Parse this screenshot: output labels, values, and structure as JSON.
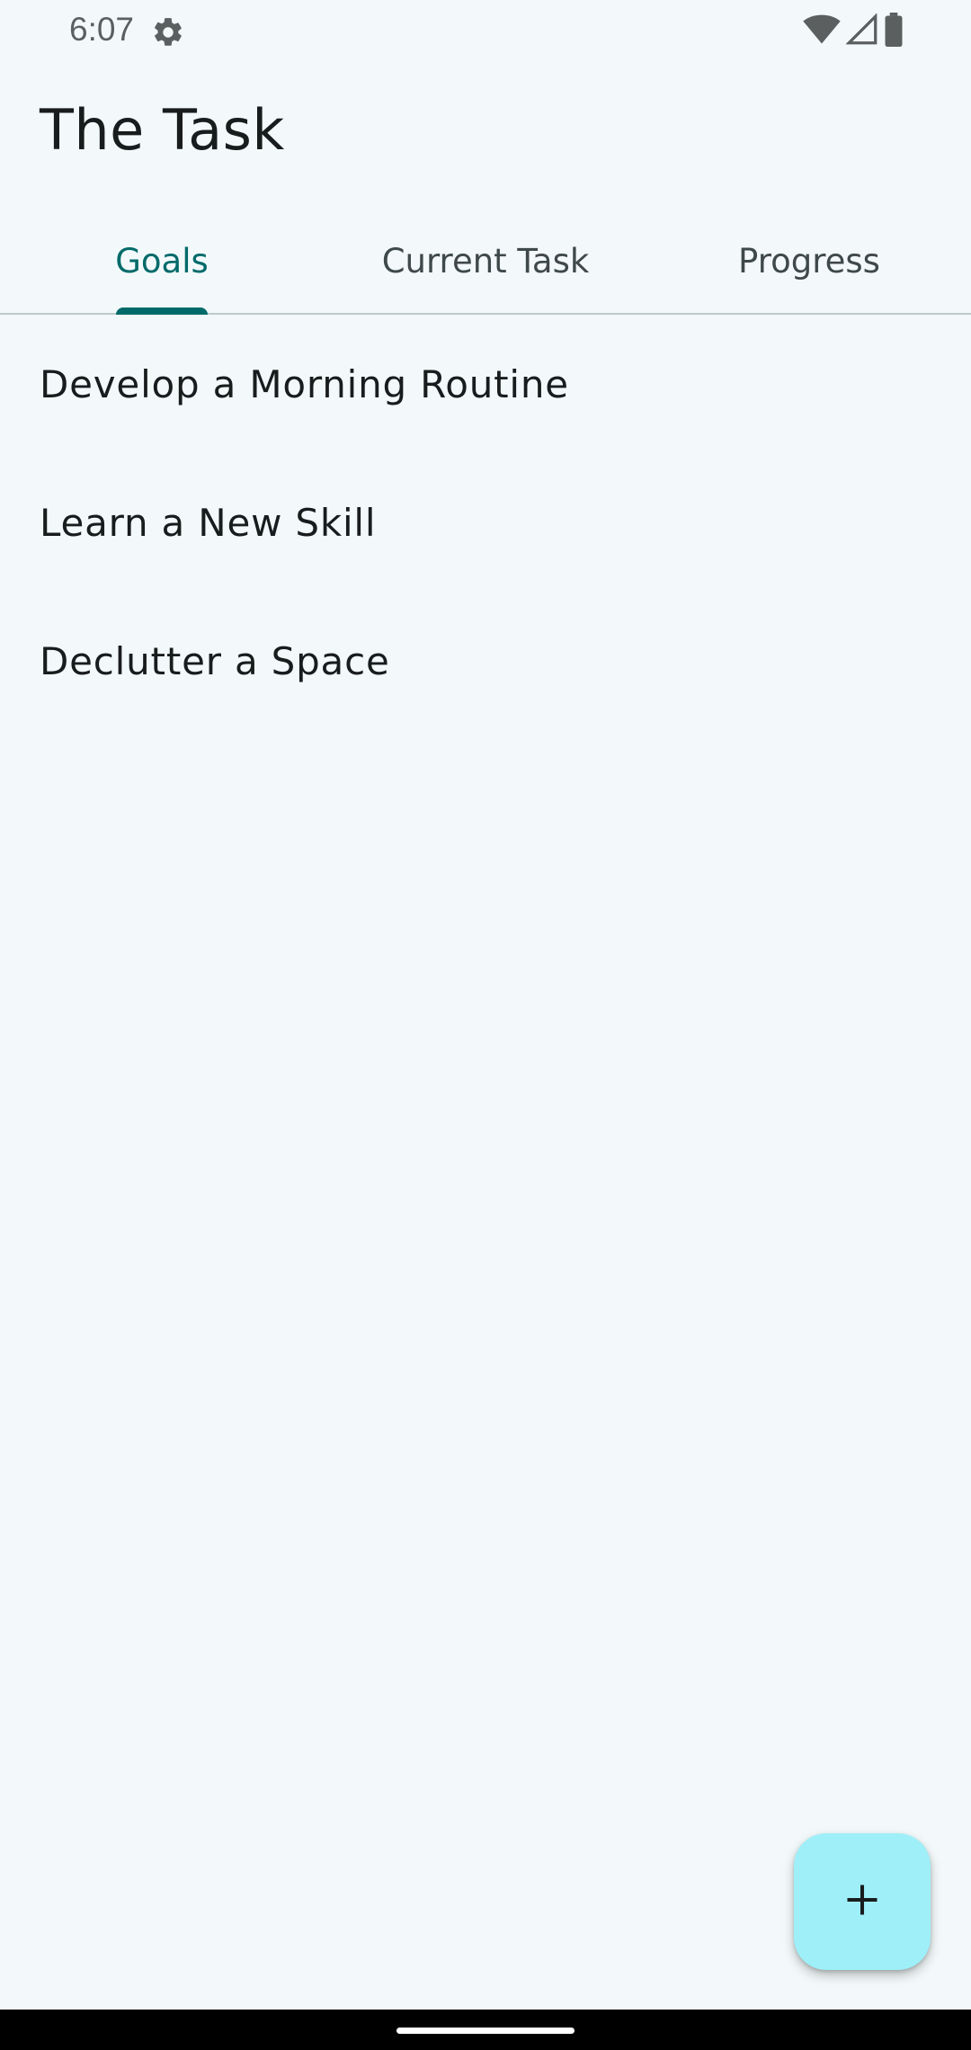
{
  "status_bar": {
    "time": "6:07",
    "icons": [
      "gear-icon",
      "wifi-icon",
      "signal-icon",
      "battery-icon"
    ]
  },
  "app": {
    "title": "The Task"
  },
  "tabs": [
    {
      "label": "Goals",
      "active": true
    },
    {
      "label": "Current Task",
      "active": false
    },
    {
      "label": "Progress",
      "active": false
    }
  ],
  "goals": [
    {
      "label": "Develop a Morning Routine"
    },
    {
      "label": "Learn a New Skill"
    },
    {
      "label": "Declutter a Space"
    }
  ],
  "fab": {
    "icon": "plus-icon"
  },
  "colors": {
    "background": "#f3f9fa",
    "accent": "#006a6a",
    "fab": "#9eeff8",
    "text": "#191c1d",
    "tab_inactive": "#3f484a"
  }
}
